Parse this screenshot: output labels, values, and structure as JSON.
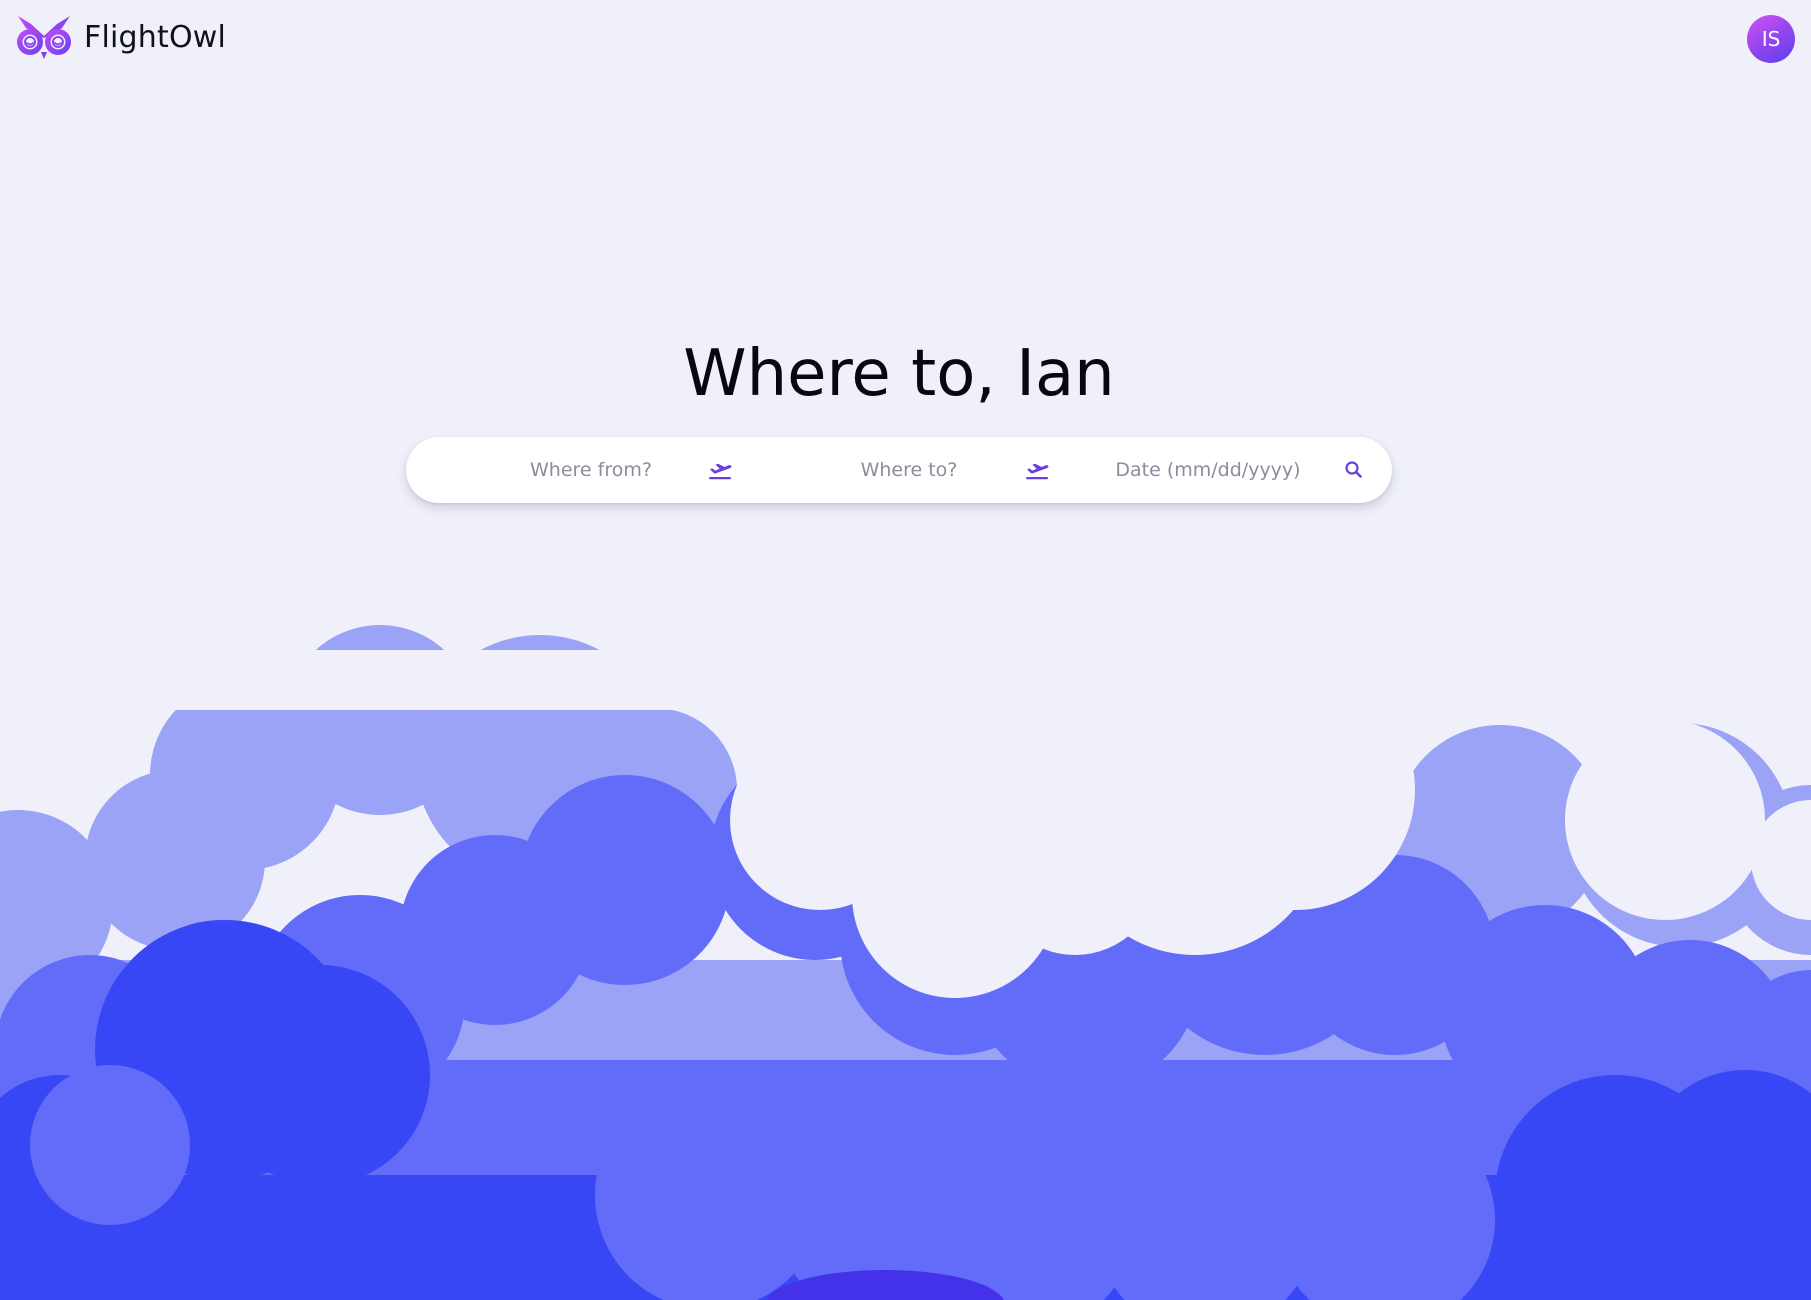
{
  "brand": {
    "name": "FlightOwl",
    "logo_icon": "owl-logo-icon",
    "accent": "#9b4dff"
  },
  "user": {
    "initials": "IS",
    "avatar_colors": [
      "#d056f2",
      "#5b3ff0"
    ]
  },
  "hero": {
    "title": "Where to, Ian"
  },
  "search": {
    "from_placeholder": "Where from?",
    "from_icon": "plane-takeoff-icon",
    "to_placeholder": "Where to?",
    "to_icon": "plane-takeoff-icon",
    "date_placeholder": "Date (mm/dd/yyyy)",
    "submit_icon": "search-icon",
    "icon_color": "#6a3fe0"
  },
  "background": {
    "page_color": "#eff0f9",
    "cloud_colors": [
      "#9ba3f6",
      "#636cf8",
      "#3847f5",
      "#4432ea"
    ]
  }
}
